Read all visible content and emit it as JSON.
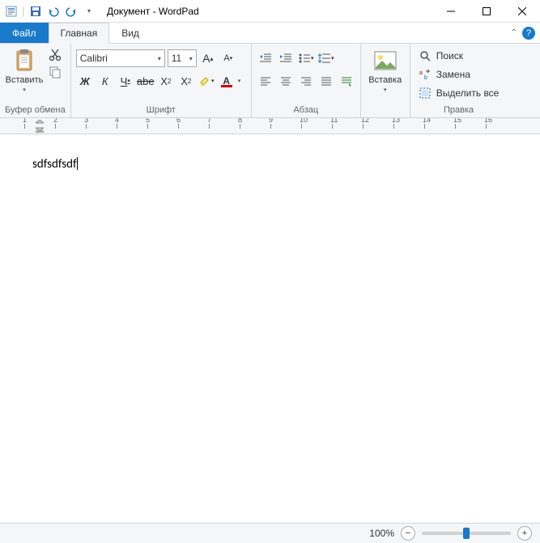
{
  "title": "Документ - WordPad",
  "tabs": {
    "file": "Файл",
    "home": "Главная",
    "view": "Вид"
  },
  "groups": {
    "clipboard": {
      "label": "Буфер обмена",
      "paste": "Вставить"
    },
    "font": {
      "label": "Шрифт",
      "name": "Calibri",
      "size": "11",
      "bold": "Ж",
      "italic": "К",
      "underline": "Ч",
      "strike": "abe",
      "sub": "X₂",
      "sup": "X²",
      "grow": "A",
      "shrink": "A"
    },
    "paragraph": {
      "label": "Абзац"
    },
    "insert": {
      "label": "",
      "button": "Вставка"
    },
    "editing": {
      "label": "Правка",
      "find": "Поиск",
      "replace": "Замена",
      "selectall": "Выделить все"
    }
  },
  "ruler": [
    "1",
    "2",
    "3",
    "4",
    "5",
    "6",
    "7",
    "8",
    "9",
    "10",
    "11",
    "12",
    "13",
    "14",
    "15",
    "16"
  ],
  "document": {
    "text": "sdfsdfsdf"
  },
  "status": {
    "zoom": "100%"
  }
}
